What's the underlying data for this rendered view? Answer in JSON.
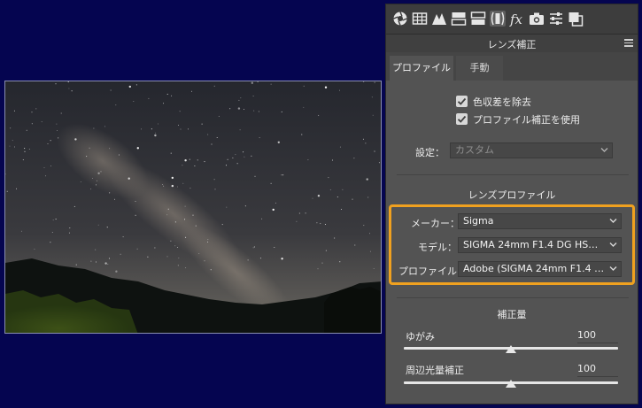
{
  "panel": {
    "title": "レンズ補正",
    "toolbar_icons": [
      "aperture-icon",
      "grid-icon",
      "tone-curve-icon",
      "split-toning-icon",
      "detail-icon",
      "lens-icon",
      "fx-icon",
      "camera-icon",
      "sliders-icon",
      "presets-icon"
    ],
    "tabs": [
      {
        "label": "プロファイル",
        "active": true
      },
      {
        "label": "手動",
        "active": false
      }
    ],
    "checkboxes": [
      {
        "label": "色収差を除去",
        "checked": true
      },
      {
        "label": "プロファイル補正を使用",
        "checked": true
      }
    ],
    "setup": {
      "label": "設定：",
      "value": "カスタム"
    },
    "lens_profile": {
      "title": "レンズプロファイル",
      "make": {
        "label": "メーカー：",
        "value": "Sigma"
      },
      "model": {
        "label": "モデル：",
        "value": "SIGMA 24mm F1.4 DG HSM ..."
      },
      "profile": {
        "label": "プロファイル：",
        "value": "Adobe (SIGMA 24mm F1.4 D..."
      }
    },
    "amount": {
      "title": "補正量",
      "distortion": {
        "label": "ゆがみ",
        "value": "100",
        "level": 1.0
      },
      "vignetting": {
        "label": "周辺光量補正",
        "value": "100",
        "level": 1.0
      }
    }
  },
  "colors": {
    "background": "#050550",
    "panel": "#535353",
    "highlight": "#f0a11f"
  }
}
